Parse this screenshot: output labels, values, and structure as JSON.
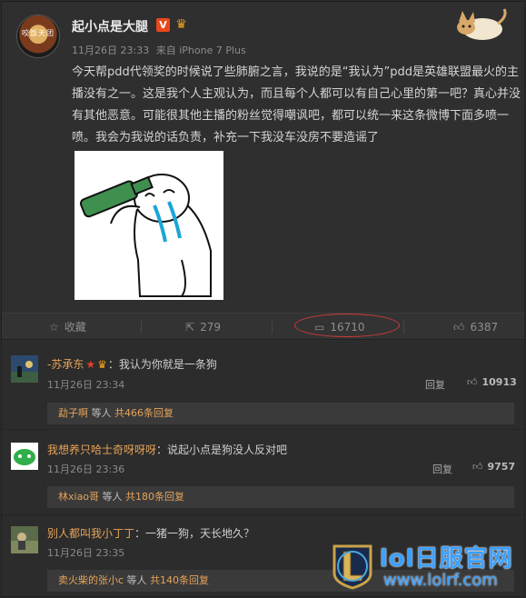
{
  "post": {
    "avatar_text": "咬饭天团",
    "username": "起小点是大腿",
    "verified_badge": "V",
    "time": "11月26日 23:33",
    "source_prefix": "来自",
    "source": "iPhone 7 Plus",
    "text": "今天帮pdd代领奖的时候说了些肺腑之言，我说的是“我认为”pdd是英雄联盟最火的主播没有之一。这是我个人主观认为，而且每个人都可以有自己心里的第一吧？真心并没有其他恶意。可能很其他主播的粉丝觉得嘲讽吧，都可以统一来这条微博下面多喷一喷。我会为我说的话负责，补充一下我没车没房不要造谣了"
  },
  "actions": {
    "favorite_label": "收藏",
    "share_count": "279",
    "comment_count": "16710",
    "like_count": "6387"
  },
  "comments": [
    {
      "user": "-苏承东",
      "text": "：我认为你就是一条狗",
      "time": "11月26日 23:34",
      "reply_label": "回复",
      "likes": "10913",
      "sub_user": "勐子啊",
      "sub_mid": " 等人 ",
      "sub_count": "共466条回复"
    },
    {
      "user": "我想养只哈士奇呀呀呀",
      "text": "：说起小点是狗没人反对吧",
      "time": "11月26日 23:36",
      "reply_label": "回复",
      "likes": "9757",
      "sub_user": "林xiao哥",
      "sub_mid": " 等人 ",
      "sub_count": "共180条回复"
    },
    {
      "user": "别人都叫我小丁丁",
      "text": "：一猪一狗，天长地久？",
      "time": "11月26日 23:35",
      "sub_user": "卖火柴的张小c",
      "sub_mid": " 等人 ",
      "sub_count": "共140条回复"
    }
  ],
  "watermark": {
    "title": "lol日服官网",
    "url": "www.lolrf.com"
  },
  "colors": {
    "username_orange": "#e5a35a",
    "highlight_red": "#d23a3a",
    "watermark_blue": "#3aa0ff"
  }
}
